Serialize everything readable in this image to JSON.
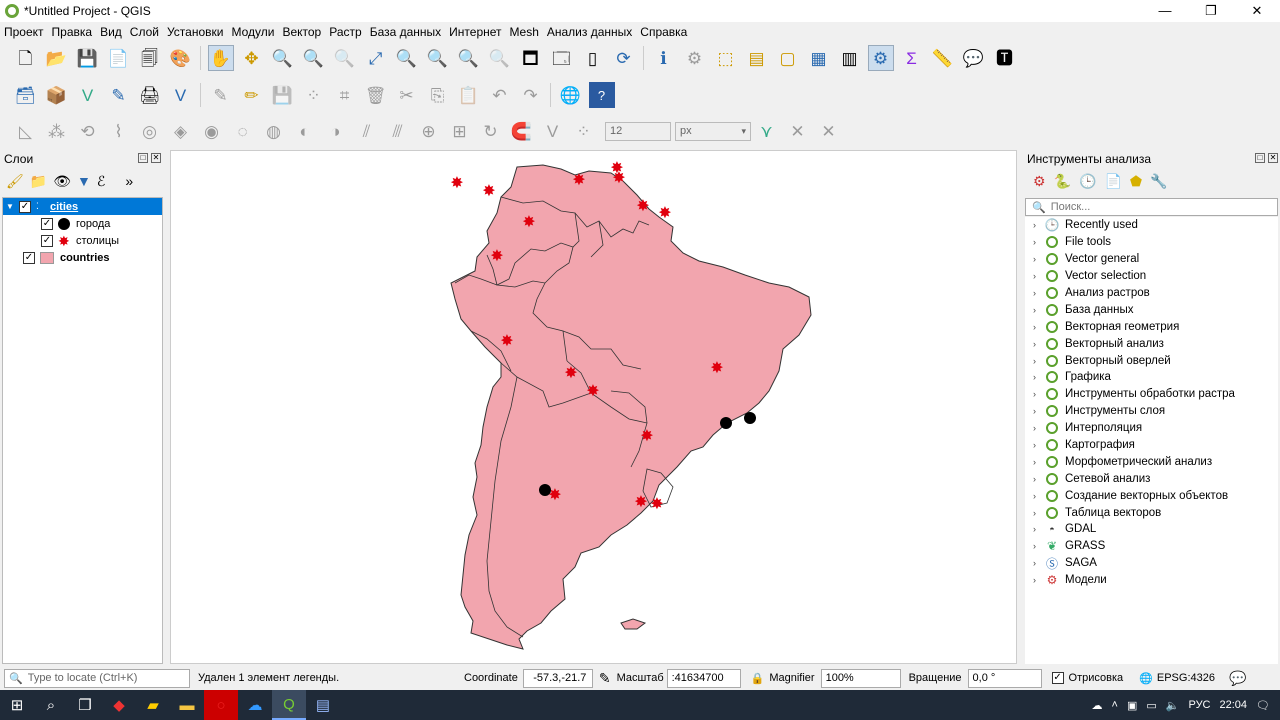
{
  "window": {
    "title": "*Untitled Project - QGIS",
    "min": "—",
    "max": "❐",
    "close": "✕"
  },
  "menu": [
    "Проект",
    "Правка",
    "Вид",
    "Слой",
    "Установки",
    "Модули",
    "Вектор",
    "Растр",
    "База данных",
    "Интернет",
    "Mesh",
    "Анализ данных",
    "Справка"
  ],
  "toolbar3": {
    "snap_value": "12",
    "snap_unit": "px"
  },
  "layers_panel": {
    "title": "Слои",
    "layers": [
      {
        "name": "cities",
        "checked": "✓"
      },
      {
        "name": "города",
        "checked": "✓"
      },
      {
        "name": "столицы",
        "checked": "✓"
      },
      {
        "name": "countries",
        "checked": "✓"
      }
    ],
    "colors": {
      "countries": "#f2a5ae",
      "cities_point": "#000000",
      "capitals": "#e0000e"
    }
  },
  "processing_panel": {
    "title": "Инструменты анализа",
    "search_placeholder": "Поиск...",
    "items": [
      "Recently used",
      "File tools",
      "Vector general",
      "Vector selection",
      "Анализ растров",
      "База данных",
      "Векторная геометрия",
      "Векторный анализ",
      "Векторный оверлей",
      "Графика",
      "Инструменты обработки растра",
      "Инструменты слоя",
      "Интерполяция",
      "Картография",
      "Морфометрический анализ",
      "Сетевой анализ",
      "Создание векторных объектов",
      "Таблица векторов",
      "GDAL",
      "GRASS",
      "SAGA",
      "Модели"
    ]
  },
  "statusbar": {
    "locate_placeholder": "Type to locate (Ctrl+K)",
    "message": "Удален 1 элемент легенды.",
    "coordinate_label": "Coordinate",
    "coordinate_value": "-57.3,-21.7",
    "scale_label": "Масштаб",
    "scale_value": ":41634700",
    "magnifier_label": "Magnifier",
    "magnifier_value": "100%",
    "rotation_label": "Вращение",
    "rotation_value": "0,0 °",
    "render_label": "Отрисовка",
    "render_checked": "✓",
    "crs": "EPSG:4326"
  },
  "taskbar": {
    "lang": "РУС",
    "time": "22:04"
  }
}
